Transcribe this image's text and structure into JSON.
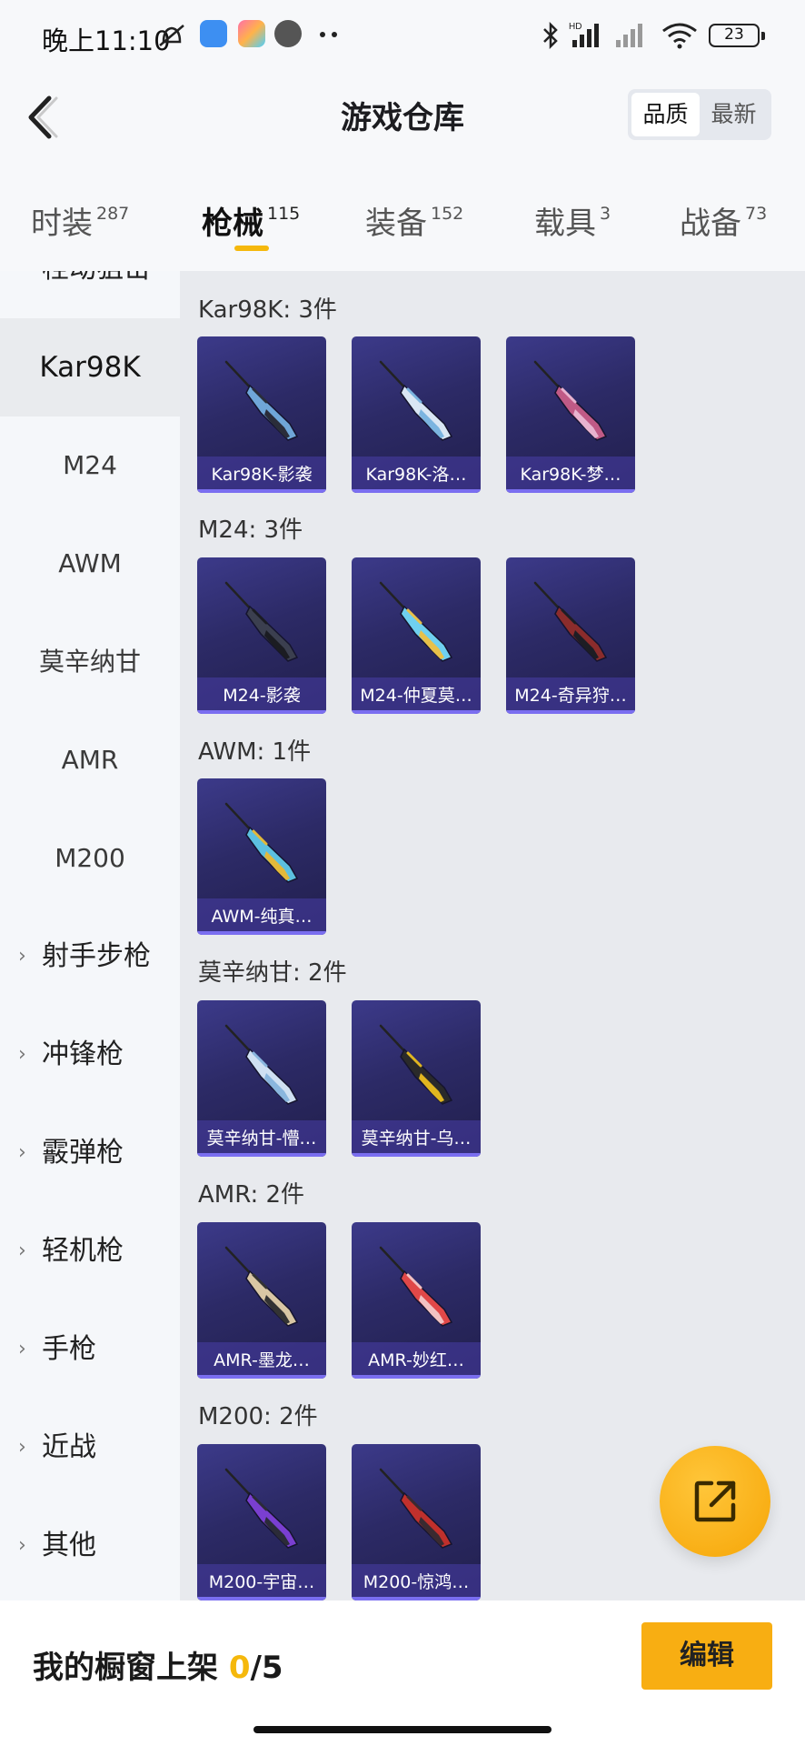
{
  "status_bar": {
    "time": "晚上11:10",
    "battery": "23",
    "icons": [
      "alarm-off-icon",
      "app-icon",
      "app-icon",
      "avatar-icon",
      "more-dots-icon",
      "bluetooth-icon",
      "hd-signal-icon",
      "signal-icon",
      "wifi-icon",
      "battery-icon"
    ]
  },
  "header": {
    "title": "游戏仓库",
    "sort_options": [
      "品质",
      "最新"
    ],
    "sort_selected": "品质"
  },
  "tabs": [
    {
      "label": "时装",
      "count": "287"
    },
    {
      "label": "枪械",
      "count": "115",
      "active": true
    },
    {
      "label": "装备",
      "count": "152"
    },
    {
      "label": "载具",
      "count": "3"
    },
    {
      "label": "战备",
      "count": "73"
    }
  ],
  "sidebar": {
    "top_partial": "栓动狙击",
    "items": [
      "Kar98K",
      "M24",
      "AWM",
      "莫辛纳甘",
      "AMR",
      "M200"
    ],
    "active": "Kar98K",
    "categories": [
      "射手步枪",
      "冲锋枪",
      "霰弹枪",
      "轻机枪",
      "手枪",
      "近战",
      "其他"
    ]
  },
  "groups": [
    {
      "title": "Kar98K: 3件",
      "cards": [
        "Kar98K-影袭",
        "Kar98K-洛…",
        "Kar98K-梦…"
      ]
    },
    {
      "title": "M24: 3件",
      "cards": [
        "M24-影袭",
        "M24-仲夏莫…",
        "M24-奇异狩…"
      ]
    },
    {
      "title": "AWM: 1件",
      "cards": [
        "AWM-纯真…"
      ]
    },
    {
      "title": "莫辛纳甘: 2件",
      "cards": [
        "莫辛纳甘-懵…",
        "莫辛纳甘-乌…"
      ]
    },
    {
      "title": "AMR: 2件",
      "cards": [
        "AMR-墨龙…",
        "AMR-妙红…"
      ]
    },
    {
      "title": "M200: 2件",
      "cards": [
        "M200-宇宙…",
        "M200-惊鸿…"
      ]
    }
  ],
  "gun_colors": [
    [
      "#6fa6d8",
      "#2a2d3a"
    ],
    [
      "#d9e6f4",
      "#7bb4e0"
    ],
    [
      "#c05a86",
      "#e8b3cf"
    ],
    [
      "#3b3f4f",
      "#1b1c22"
    ],
    [
      "#6fd0f0",
      "#e8c04a"
    ],
    [
      "#8b2c2c",
      "#1d1d24"
    ],
    [
      "#5cc0e0",
      "#e2b83a"
    ],
    [
      "#cfe0f2",
      "#8ab6de"
    ],
    [
      "#2a2a2a",
      "#e0b620"
    ],
    [
      "#d9c7a4",
      "#333333"
    ],
    [
      "#e04848",
      "#f2c2c2"
    ],
    [
      "#7a3fd0",
      "#2b2b38"
    ],
    [
      "#c0302c",
      "#3a2a30"
    ]
  ],
  "bottom": {
    "label": "我的橱窗上架",
    "count": "0",
    "total": "/5",
    "edit_label": "编辑"
  },
  "fab_icon": "share-external-icon"
}
